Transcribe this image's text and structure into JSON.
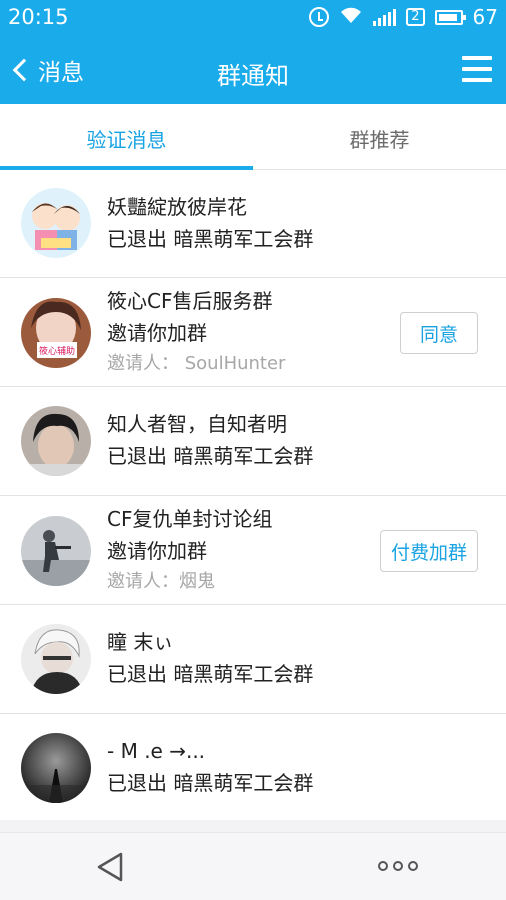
{
  "status_bar": {
    "time": "20:15",
    "sim_slot": "2",
    "battery": "67"
  },
  "nav": {
    "back_label": "消息",
    "title": "群通知"
  },
  "tabs": [
    {
      "label": "验证消息",
      "active": true
    },
    {
      "label": "群推荐",
      "active": false
    }
  ],
  "notifications": [
    {
      "name": "妖豔綻放彼岸花",
      "message": "已退出 暗黑萌军工会群"
    },
    {
      "name": "筱心CF售后服务群",
      "message": "邀请你加群",
      "inviter": "邀请人：  SoulHunter",
      "action": "同意",
      "avatar_text": "筱心辅助"
    },
    {
      "name": "知人者智，自知者明",
      "message": "已退出 暗黑萌军工会群"
    },
    {
      "name": "CF复仇单封讨论组",
      "message": "邀请你加群",
      "inviter": "邀请人：烟鬼",
      "action": "付费加群"
    },
    {
      "name": "瞳 末ぃ",
      "message": "已退出 暗黑萌军工会群"
    },
    {
      "name": "-  M .e →...",
      "message": "已退出 暗黑萌军工会群"
    }
  ],
  "colors": {
    "accent": "#1aabeb",
    "divider": "#e3e3e3"
  },
  "bottom_bar": {
    "back_icon": "back-triangle-icon",
    "more_icon": "more-dots-icon"
  }
}
